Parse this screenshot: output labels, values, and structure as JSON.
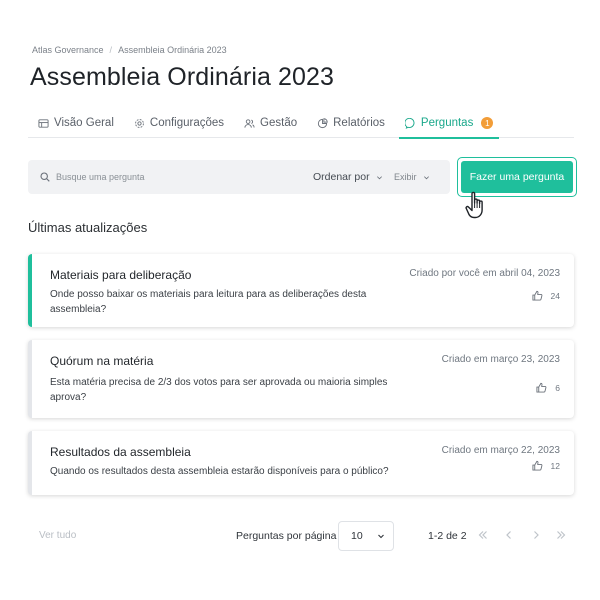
{
  "breadcrumb": [
    "Atlas Governance",
    "Assembleia Ordinária 2023"
  ],
  "page_title": "Assembleia Ordinária 2023",
  "tabs": [
    {
      "label": "Visão Geral",
      "icon": "overview-icon"
    },
    {
      "label": "Configurações",
      "icon": "gear-icon"
    },
    {
      "label": "Gestão",
      "icon": "people-icon"
    },
    {
      "label": "Relatórios",
      "icon": "pie-chart-icon"
    },
    {
      "label": "Perguntas",
      "icon": "chat-icon",
      "badge": "1",
      "active": true
    }
  ],
  "toolbar": {
    "search_placeholder": "Busque uma pergunta",
    "sort_label": "Ordenar por",
    "show_label": "Exibir",
    "ask_button": "Fazer uma pergunta"
  },
  "section_title": "Últimas atualizações",
  "questions": [
    {
      "title": "Materiais para deliberação",
      "date": "Criado por você em abril 04, 2023",
      "body": "Onde posso baixar os materiais para leitura para as deliberações desta assembleia?",
      "likes": "24",
      "active": true
    },
    {
      "title": "Quórum na matéria",
      "date": "Criado em março 23, 2023",
      "body": "Esta matéria precisa de 2/3 dos votos para ser aprovada ou maioria simples aprova?",
      "likes": "6"
    },
    {
      "title": "Resultados da assembleia",
      "date": "Criado em março 22, 2023",
      "body": "Quando os resultados desta assembleia estarão disponíveis para o público?",
      "likes": "12"
    }
  ],
  "footer": {
    "see_all": "Ver tudo",
    "per_page_label": "Perguntas por página",
    "per_page_value": "10",
    "range": "1-2 de 2"
  },
  "colors": {
    "accent": "#1fbf9c",
    "badge": "#f29d38"
  }
}
